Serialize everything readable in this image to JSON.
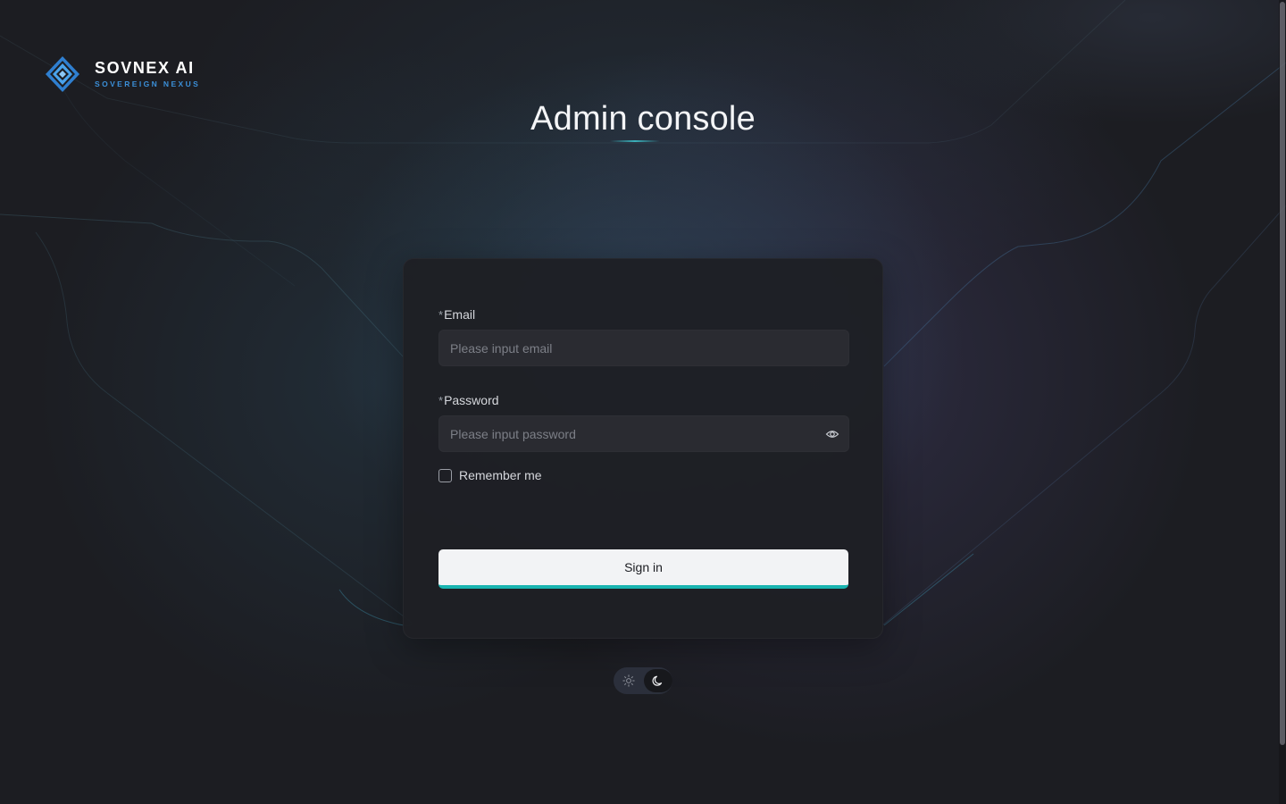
{
  "brand": {
    "name": "SOVNEX AI",
    "tagline": "SOVEREIGN NEXUS",
    "accent_color": "#3b8fd8"
  },
  "page": {
    "title": "Admin console"
  },
  "form": {
    "email": {
      "required_mark": "*",
      "label": "Email",
      "placeholder": "Please input email",
      "value": ""
    },
    "password": {
      "required_mark": "*",
      "label": "Password",
      "placeholder": "Please input password",
      "value": "",
      "toggle_icon": "eye-icon"
    },
    "remember": {
      "label": "Remember me",
      "checked": false
    },
    "submit": {
      "label": "Sign in",
      "accent_color": "#19b4b0"
    }
  },
  "theme_toggle": {
    "options": [
      "sun-icon",
      "moon-icon"
    ],
    "selected": "moon-icon"
  }
}
